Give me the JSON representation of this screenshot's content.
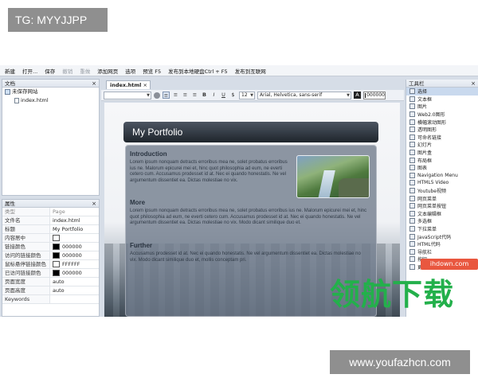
{
  "badges": {
    "top_left": "TG: MYYJJPP",
    "bottom_right": "www.youfazhcn.com"
  },
  "menubar": {
    "items": [
      {
        "label": "新建",
        "dim": false
      },
      {
        "label": "打开...",
        "dim": false
      },
      {
        "label": "保存",
        "dim": false
      },
      {
        "label": "撤销",
        "dim": true
      },
      {
        "label": "重做",
        "dim": true
      },
      {
        "label": "添加网页",
        "dim": false
      },
      {
        "label": "选项",
        "dim": false
      },
      {
        "label": "预览 F5",
        "dim": false
      },
      {
        "label": "发布到本地硬盘Ctrl + F5",
        "dim": false
      },
      {
        "label": "发布到互联网",
        "dim": false
      }
    ]
  },
  "docs_panel": {
    "title": "文档",
    "site": "未保存网站",
    "page": "index.html"
  },
  "props_panel": {
    "title": "属性",
    "header": {
      "k": "类型",
      "v": "Page"
    },
    "rows": [
      {
        "k": "文件名",
        "v": "index.html",
        "color": ""
      },
      {
        "k": "标题",
        "v": "My Portfolio",
        "color": ""
      },
      {
        "k": "内容居中",
        "v": "",
        "color": "#ffffff"
      },
      {
        "k": "链接颜色",
        "v": "000000",
        "color": "#000000"
      },
      {
        "k": "访问的链接颜色",
        "v": "000000",
        "color": "#000000"
      },
      {
        "k": "鼠标悬停链接颜色",
        "v": "FFFFFF",
        "color": "#ffffff"
      },
      {
        "k": "已访问链接颜色",
        "v": "000000",
        "color": "#000000"
      },
      {
        "k": "页面宽度",
        "v": "auto",
        "color": ""
      },
      {
        "k": "页面高度",
        "v": "auto",
        "color": ""
      },
      {
        "k": "Keywords",
        "v": "",
        "color": ""
      }
    ]
  },
  "editor": {
    "tab": "index.html",
    "font_size": "12",
    "font_family": "Arial, Helvetica, sans-serif",
    "color_value": "000000"
  },
  "page": {
    "header": "My Portfolio",
    "sections": [
      {
        "title": "Introduction",
        "body": "Lorem ipsum nonquam detracts erroribus mea ne, solet probatus erroribus ius ne. Malorum epicurei mei et, hinc quot philosophia ad eum, ne everti cetero cum. Accusamus prodesset id at. Nec ei quando honestatis. Ne vel argumentum dissentiet ea. Dictas molestiae no vix."
      },
      {
        "title": "More",
        "body": "Lorem ipsum nonquam detracts erroribus mea ne, solet probatus erroribus ius ne. Malorum epicurei mei et, hinc quot philosophia ad eum, ne everti cetero cum. Accusamus prodesset id at. Nec ei quando honestatis. Ne vel argumentum dissentiet ea. Dictas molestiae no vix. Modo dicant similique duo et."
      },
      {
        "title": "Further",
        "body": "Accusamus prodesset id at. Nec ei quando honestatis. Ne vel argumentum dissentiet ea. Dictas molestiae no vix. Modo dicant similique duo et, mollis conceptam pri."
      }
    ]
  },
  "toolbox": {
    "title": "工具栏",
    "items": [
      "选择",
      "文本框",
      "图片",
      "Web2.0图形",
      "横幅滚动图形",
      "透明图形",
      "可命名链接",
      "幻灯片",
      "图片盒",
      "布局框",
      "图表",
      "Navigation Menu",
      "HTML5 Video",
      "Youtube视频",
      "网页菜单",
      "网页菜单按钮",
      "文本编辑框",
      "多选框",
      "下拉菜单",
      "JavaScript代码",
      "HTML代码",
      "导航栏",
      "按钮",
      "更多"
    ]
  },
  "watermark": {
    "text": "领航下载",
    "url": "ihdown.com"
  }
}
